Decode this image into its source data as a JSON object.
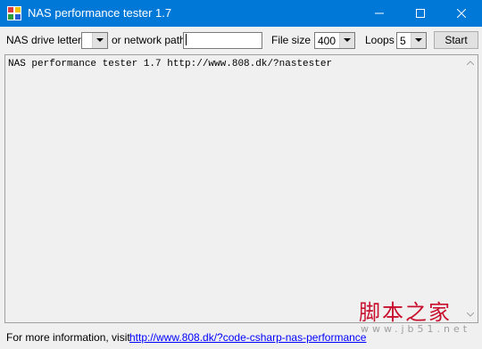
{
  "window": {
    "title": "NAS performance tester 1.7",
    "controls": [
      "minimize-icon",
      "maximize-icon",
      "close-icon"
    ]
  },
  "toolbar": {
    "drive_label": "NAS drive letter",
    "drive_value": "",
    "path_label": "or network path",
    "path_value": "",
    "filesize_label": "File size",
    "filesize_value": "400",
    "loops_label": "Loops",
    "loops_value": "5",
    "start_label": "Start"
  },
  "log": {
    "text": "NAS performance tester 1.7 http://www.808.dk/?nastester"
  },
  "footer": {
    "info_text": "For more information, visit",
    "link_text": "http://www.808.dk/?code-csharp-nas-performance"
  },
  "watermark": {
    "main": "脚本之家",
    "sub": "www.jb51.net"
  },
  "colors": {
    "titlebar": "#0078d7",
    "window_bg": "#f0f0f0",
    "link": "#0000ff",
    "watermark": "#c8102e"
  }
}
